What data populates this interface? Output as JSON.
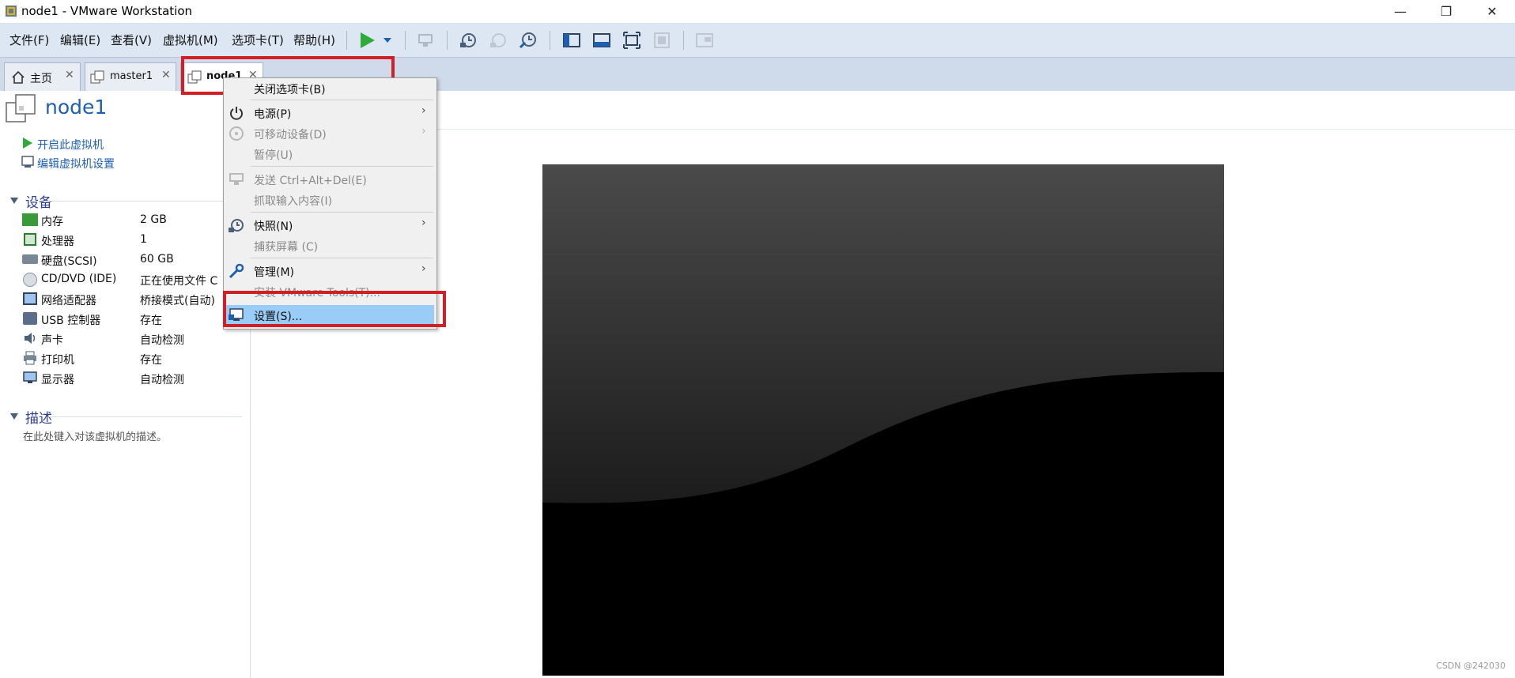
{
  "window": {
    "title": "node1 - VMware Workstation",
    "controls": {
      "minimize": "—",
      "restore": "❐",
      "close": "✕"
    }
  },
  "menubar": {
    "items": [
      "文件(F)",
      "编辑(E)",
      "查看(V)",
      "虚拟机(M)",
      "选项卡(T)",
      "帮助(H)"
    ]
  },
  "tabs": [
    {
      "label": "主页",
      "close": "✕"
    },
    {
      "label": "master1",
      "close": "✕"
    },
    {
      "label": "node1",
      "close": "✕"
    }
  ],
  "vm": {
    "name": "node1",
    "actions": [
      "开启此虚拟机",
      "编辑虚拟机设置"
    ]
  },
  "devices": {
    "section_title": "设备",
    "items": [
      {
        "name": "内存",
        "value": "2 GB",
        "icon": "memory-icon"
      },
      {
        "name": "处理器",
        "value": "1",
        "icon": "cpu-icon"
      },
      {
        "name": "硬盘(SCSI)",
        "value": "60 GB",
        "icon": "harddisk-icon"
      },
      {
        "name": "CD/DVD (IDE)",
        "value": "正在使用文件 C",
        "icon": "cd-icon"
      },
      {
        "name": "网络适配器",
        "value": "桥接模式(自动)",
        "icon": "network-icon"
      },
      {
        "name": "USB 控制器",
        "value": "存在",
        "icon": "usb-icon"
      },
      {
        "name": "声卡",
        "value": "自动检测",
        "icon": "sound-icon"
      },
      {
        "name": "打印机",
        "value": "存在",
        "icon": "printer-icon"
      },
      {
        "name": "显示器",
        "value": "自动检测",
        "icon": "display-icon"
      }
    ]
  },
  "description": {
    "section_title": "描述",
    "placeholder": "在此处键入对该虚拟机的描述。"
  },
  "context_menu": {
    "items": [
      {
        "label": "关闭选项卡(B)",
        "disabled": false
      },
      {
        "label": "电源(P)",
        "disabled": false,
        "submenu": true
      },
      {
        "label": "可移动设备(D)",
        "disabled": true,
        "submenu": true
      },
      {
        "label": "暂停(U)",
        "disabled": true
      },
      {
        "label": "发送 Ctrl+Alt+Del(E)",
        "disabled": true
      },
      {
        "label": "抓取输入内容(I)",
        "disabled": true
      },
      {
        "label": "快照(N)",
        "disabled": false,
        "submenu": true
      },
      {
        "label": "捕获屏幕 (C)",
        "disabled": true
      },
      {
        "label": "管理(M)",
        "disabled": false,
        "submenu": true
      },
      {
        "label": "安装 VMware Tools(T)...",
        "disabled": true
      },
      {
        "label": "设置(S)...",
        "disabled": false,
        "highlighted": true
      }
    ],
    "arrow": "›"
  },
  "watermark": "CSDN @242030",
  "colors": {
    "accent": "#1e5fb0",
    "highlight": "#d21f26",
    "menu_highlight": "#99ccf6"
  }
}
